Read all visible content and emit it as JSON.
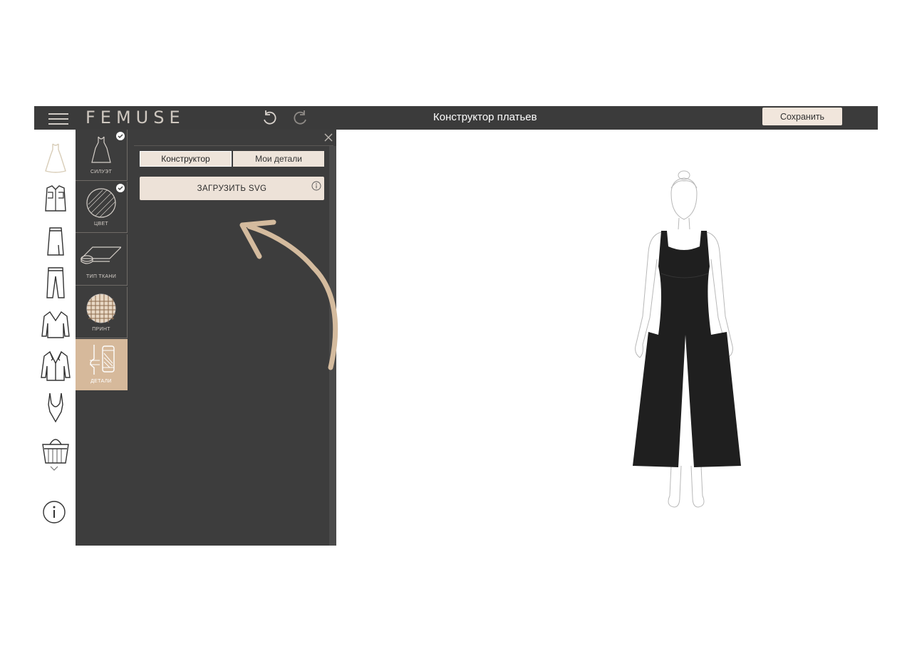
{
  "app": {
    "logo": "FEMUSE",
    "title": "Конструктор платьев",
    "save_label": "Сохранить",
    "icons": {
      "menu": "menu-icon",
      "undo": "undo-icon",
      "redo": "redo-icon"
    }
  },
  "categories": [
    "dress-icon",
    "shirt-icon",
    "skirt-icon",
    "trousers-icon",
    "sweater-icon",
    "jacket-icon",
    "swimsuit-icon",
    "bag-icon"
  ],
  "tabs": [
    {
      "label": "СИЛУЭТ",
      "icon": "silhouette-icon",
      "checked": true
    },
    {
      "label": "ЦВЕТ",
      "icon": "color-icon",
      "checked": true
    },
    {
      "label": "ТИП ТКАНИ",
      "icon": "fabric-icon",
      "checked": false
    },
    {
      "label": "ПРИНТ",
      "icon": "print-icon",
      "checked": false
    },
    {
      "label": "ДЕТАЛИ",
      "icon": "details-icon",
      "checked": false,
      "active": true
    }
  ],
  "panel": {
    "segments": [
      "Конструктор",
      "Мои детали"
    ],
    "upload_label": "ЗАГРУЗИТЬ SVG"
  },
  "colors": {
    "dark": "#3d3d3d",
    "accent": "#d6b99b",
    "arrow": "#d4bb9e",
    "garment": "#1f1f1f"
  }
}
